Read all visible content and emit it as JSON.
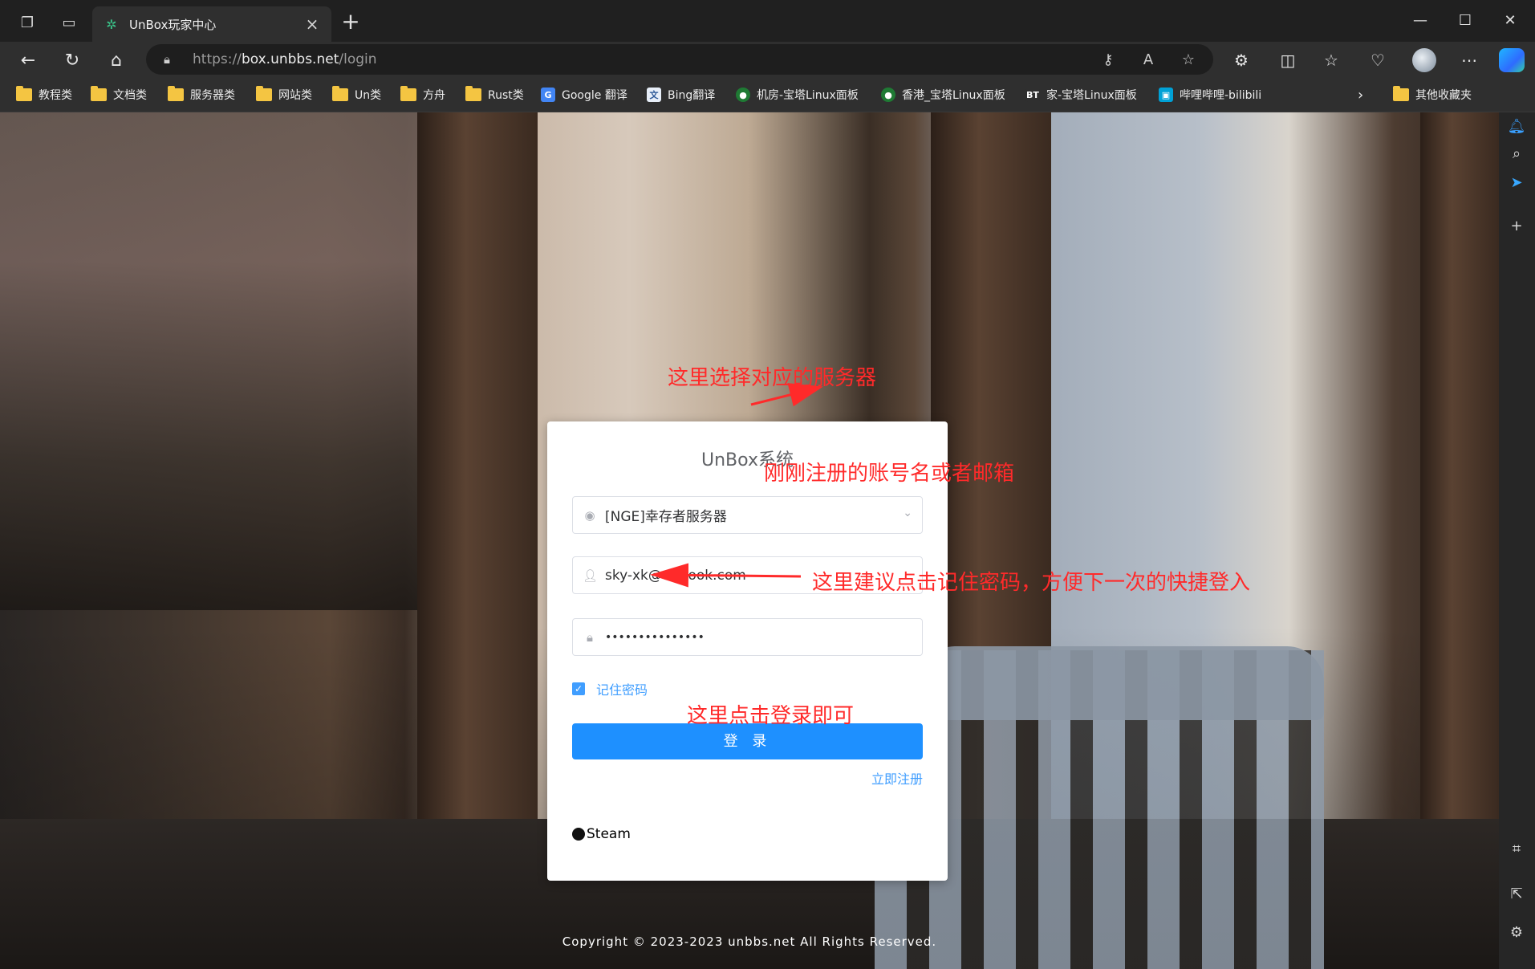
{
  "browser": {
    "tab_title": "UnBox玩家中心",
    "url_scheme": "https://",
    "url_host": "box.unbbs.net",
    "url_path": "/login",
    "favorites": [
      {
        "label": "教程类",
        "icon": "folder-icon"
      },
      {
        "label": "文档类",
        "icon": "folder-icon"
      },
      {
        "label": "服务器类",
        "icon": "folder-icon"
      },
      {
        "label": "网站类",
        "icon": "folder-icon"
      },
      {
        "label": "Un类",
        "icon": "folder-icon"
      },
      {
        "label": "方舟",
        "icon": "folder-icon"
      },
      {
        "label": "Rust类",
        "icon": "folder-icon"
      },
      {
        "label": "Google 翻译",
        "icon": "google-translate-icon"
      },
      {
        "label": "Bing翻译",
        "icon": "bing-translate-icon"
      },
      {
        "label": "机房-宝塔Linux面板",
        "icon": "bt-panel-icon"
      },
      {
        "label": "香港_宝塔Linux面板",
        "icon": "bt-panel-icon"
      },
      {
        "label": "家-宝塔Linux面板",
        "icon": "bt-icon"
      },
      {
        "label": "哔哩哔哩-bilibili",
        "icon": "bilibili-icon"
      }
    ],
    "other_favorites": "其他收藏夹"
  },
  "login": {
    "title": "UnBox系统",
    "server_value": "[NGE]幸存者服务器",
    "account_value": "sky-xk@outlook.com",
    "password_mask": "•••••••••••••••",
    "remember_label": "记住密码",
    "remember_checked": true,
    "login_button": "登 录",
    "register_link": "立即注册",
    "steam_label": "Steam"
  },
  "footer": {
    "copyright": "Copyright © 2023-2023 unbbs.net All Rights Reserved."
  },
  "annotations": {
    "server_note": "这里选择对应的服务器",
    "account_note": "刚刚注册的账号名或者邮箱",
    "remember_note": "这里建议点击记住密码，方便下一次的快捷登入",
    "login_note": "这里点击登录即可"
  },
  "colors": {
    "accent": "#409eff",
    "button": "#1e90ff",
    "annotation": "#ff2a2a"
  }
}
